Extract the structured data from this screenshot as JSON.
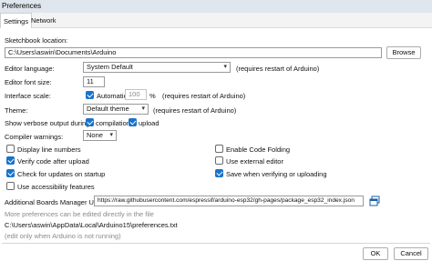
{
  "window": {
    "title": "Preferences"
  },
  "tabs": [
    {
      "label": "Settings"
    },
    {
      "label": "Network"
    }
  ],
  "sketchbook": {
    "label": "Sketchbook location:",
    "value": "C:\\Users\\aswin\\Documents\\Arduino",
    "browse_label": "Browse"
  },
  "editor_language": {
    "label": "Editor language:",
    "value": "System Default",
    "note": "(requires restart of Arduino)"
  },
  "editor_font_size": {
    "label": "Editor font size:",
    "value": "11"
  },
  "interface_scale": {
    "label": "Interface scale:",
    "automatic_label": "Automatic",
    "automatic_checked": true,
    "value": "100",
    "percent": "%",
    "note": "(requires restart of Arduino)"
  },
  "theme": {
    "label": "Theme:",
    "value": "Default theme",
    "note": "(requires restart of Arduino)"
  },
  "verbose": {
    "label": "Show verbose output during:",
    "compilation_label": "compilation",
    "compilation_checked": true,
    "upload_label": "upload",
    "upload_checked": true
  },
  "compiler_warnings": {
    "label": "Compiler warnings:",
    "value": "None"
  },
  "options_left": [
    {
      "label": "Display line numbers",
      "checked": false
    },
    {
      "label": "Verify code after upload",
      "checked": true
    },
    {
      "label": "Check for updates on startup",
      "checked": true
    },
    {
      "label": "Use accessibility features",
      "checked": false
    }
  ],
  "options_right": [
    {
      "label": "Enable Code Folding",
      "checked": false
    },
    {
      "label": "Use external editor",
      "checked": false
    },
    {
      "label": "Save when verifying or uploading",
      "checked": true
    }
  ],
  "boards_manager": {
    "label": "Additional Boards Manager URLs:",
    "value": "https://raw.githubusercontent.com/espressif/arduino-esp32/gh-pages/package_esp32_index.json"
  },
  "footer": {
    "more_prefs": "More preferences can be edited directly in the file",
    "prefs_path": "C:\\Users\\aswin\\AppData\\Local\\Arduino15\\preferences.txt",
    "edit_note": "(edit only when Arduino is not running)",
    "ok_label": "OK",
    "cancel_label": "Cancel"
  },
  "colors": {
    "accent": "#1a73c9",
    "titlebar": "#dfe6ee"
  }
}
